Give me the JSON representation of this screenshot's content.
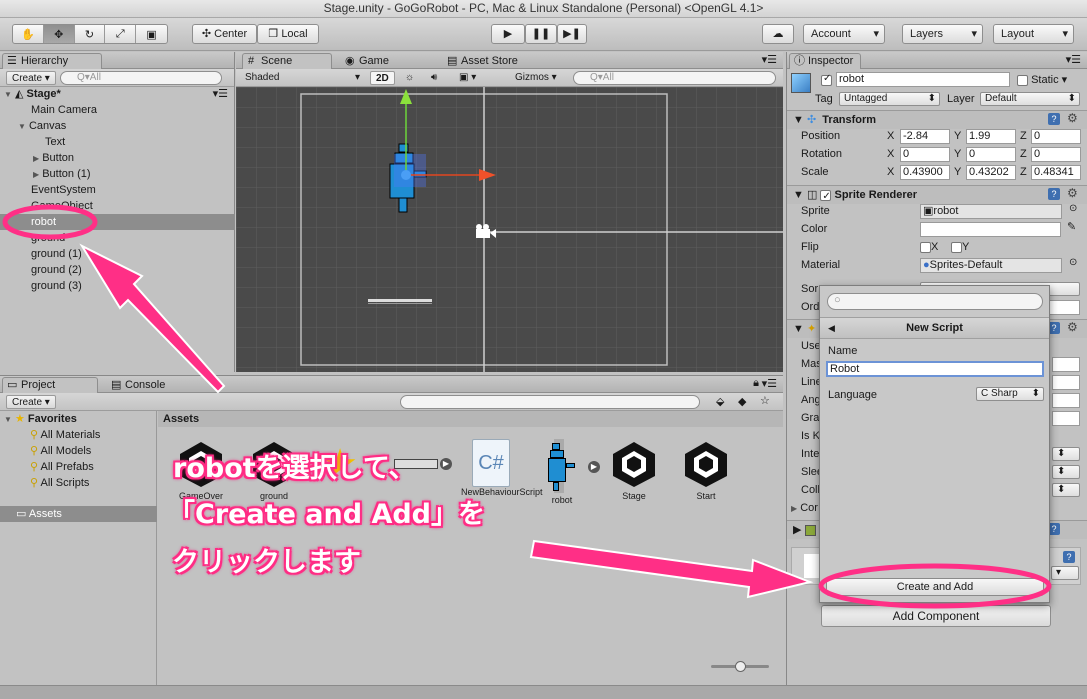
{
  "window": {
    "title": "Stage.unity - GoGoRobot - PC, Mac & Linux Standalone (Personal) <OpenGL 4.1>"
  },
  "toolbar": {
    "pivot_label": "Center",
    "space_label": "Local",
    "account_label": "Account",
    "layers_label": "Layers",
    "layout_label": "Layout"
  },
  "hierarchy": {
    "tab": "Hierarchy",
    "create_label": "Create",
    "search_placeholder": "Q▾All",
    "scene": "Stage*",
    "items": [
      "Main Camera",
      "Canvas",
      "Text",
      "Button",
      "Button (1)",
      "EventSystem",
      "GameObject",
      "robot",
      "ground",
      "ground (1)",
      "ground (2)",
      "ground (3)"
    ]
  },
  "scene_view": {
    "tabs": [
      "Scene",
      "Game",
      "Asset Store"
    ],
    "shading": "Shaded",
    "mode_2d": "2D",
    "gizmos": "Gizmos",
    "search_placeholder": "Q▾All"
  },
  "project": {
    "tabs": [
      "Project",
      "Console"
    ],
    "create_label": "Create",
    "favorites_label": "Favorites",
    "favorites": [
      "All Materials",
      "All Models",
      "All Prefabs",
      "All Scripts"
    ],
    "assets_folder": "Assets",
    "breadcrumb": "Assets",
    "assets": [
      {
        "name": "GameOver",
        "icon": "unity-scene-icon"
      },
      {
        "name": "ground",
        "icon": "unity-scene-icon"
      },
      {
        "name": "",
        "icon": "star-prefab-icon"
      },
      {
        "name": "",
        "icon": "ground-sprite-icon"
      },
      {
        "name": "NewBehaviourScript",
        "icon": "csharp-script-icon"
      },
      {
        "name": "robot",
        "icon": "robot-sprite-icon"
      },
      {
        "name": "Stage",
        "icon": "unity-scene-icon"
      },
      {
        "name": "Start",
        "icon": "unity-scene-icon"
      }
    ]
  },
  "inspector": {
    "tab": "Inspector",
    "object_name": "robot",
    "static_label": "Static",
    "tag_label": "Tag",
    "tag_value": "Untagged",
    "layer_label": "Layer",
    "layer_value": "Default",
    "transform": {
      "title": "Transform",
      "position_label": "Position",
      "position": [
        "-2.84",
        "1.99",
        "0"
      ],
      "rotation_label": "Rotation",
      "rotation": [
        "0",
        "0",
        "0"
      ],
      "scale_label": "Scale",
      "scale": [
        "0.43900",
        "0.43202",
        "0.48341"
      ],
      "axes": [
        "X",
        "Y",
        "Z"
      ]
    },
    "sprite_renderer": {
      "title": "Sprite Renderer",
      "sprite_label": "Sprite",
      "sprite_value": "robot",
      "color_label": "Color",
      "flip_label": "Flip",
      "flip_x": "X",
      "flip_y": "Y",
      "material_label": "Material",
      "material_value": "Sprites-Default",
      "partial_rows": [
        "Sor",
        "Ord"
      ]
    },
    "rigidbody_partial_rows": [
      "Use",
      "Mas",
      "Line",
      "Ang",
      "Gra",
      "Is K",
      "Inte",
      "Slee",
      "Colli",
      "Cor"
    ],
    "add_component_label": "Add Component"
  },
  "new_script_popup": {
    "title": "New Script",
    "name_label": "Name",
    "name_value": "Robot",
    "language_label": "Language",
    "language_value": "C Sharp",
    "create_button": "Create and Add"
  },
  "annotation": {
    "line1": "robotを選択して、",
    "line2": "「Create and Add」を",
    "line3": "クリックします",
    "color": "#ff2f86"
  }
}
